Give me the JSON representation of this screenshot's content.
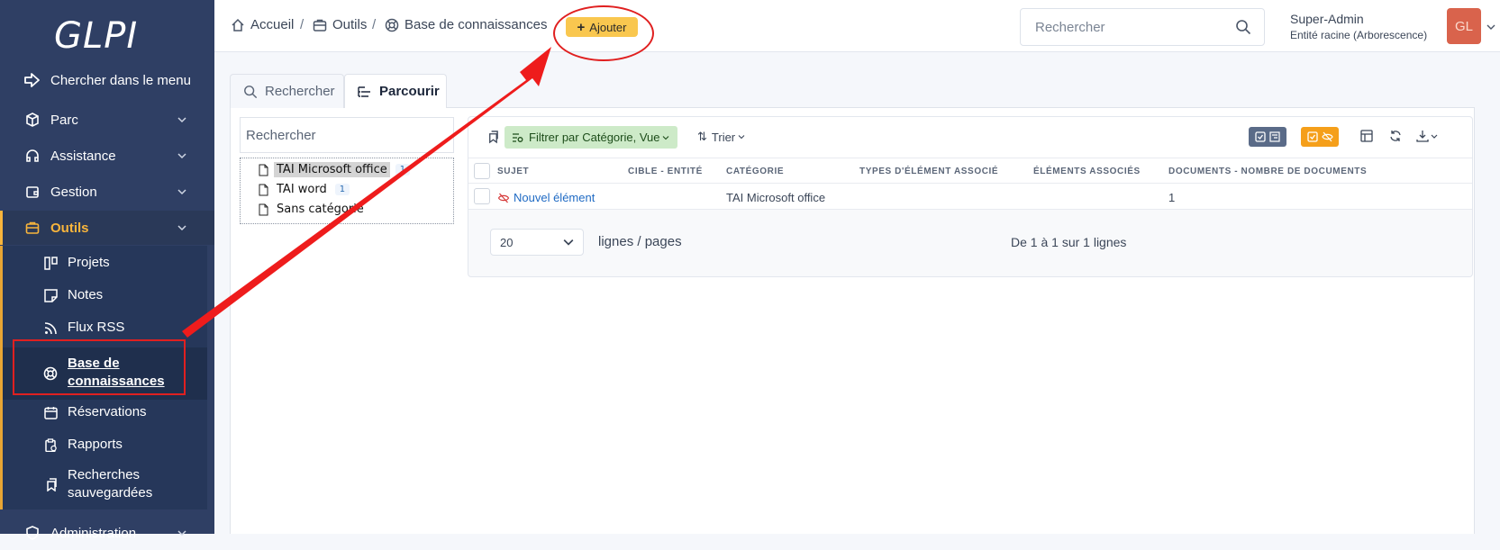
{
  "sidebar": {
    "logo": "GLPI",
    "search_label": "Chercher dans le menu",
    "items": [
      {
        "label": "Parc",
        "icon": "cube-icon"
      },
      {
        "label": "Assistance",
        "icon": "headset-icon"
      },
      {
        "label": "Gestion",
        "icon": "wallet-icon"
      },
      {
        "label": "Outils",
        "icon": "briefcase-icon"
      },
      {
        "label": "Administration",
        "icon": "shield-icon"
      }
    ],
    "submenu": [
      {
        "label": "Projets",
        "icon": "columns-icon"
      },
      {
        "label": "Notes",
        "icon": "note-icon"
      },
      {
        "label": "Flux RSS",
        "icon": "rss-icon"
      },
      {
        "label": "Base de connaissances",
        "line1": "Base de",
        "line2": "connaissances",
        "icon": "lifebuoy-icon"
      },
      {
        "label": "Réservations",
        "icon": "calendar-icon"
      },
      {
        "label": "Rapports",
        "icon": "report-icon"
      },
      {
        "label": "Recherches sauvegardées",
        "line1": "Recherches",
        "line2": "sauvegardées",
        "icon": "bookmark-icon"
      }
    ]
  },
  "breadcrumb": [
    "Accueil",
    "Outils",
    "Base de connaissances"
  ],
  "add_label": "Ajouter",
  "search": {
    "placeholder": "Rechercher"
  },
  "user": {
    "name": "Super-Admin",
    "entity": "Entité racine (Arborescence)",
    "initials": "GL"
  },
  "tabs": [
    "Rechercher",
    "Parcourir"
  ],
  "tree": {
    "search_placeholder": "Rechercher",
    "items": [
      {
        "label": "TAI Microsoft office",
        "count": "1"
      },
      {
        "label": "TAI word",
        "count": "1"
      },
      {
        "label": "Sans catégorie",
        "count": ""
      }
    ]
  },
  "toolbar": {
    "filter_label": "Filtrer par Catégorie, Vue",
    "sort_label": "Trier"
  },
  "table": {
    "columns": [
      "SUJET",
      "CIBLE - ENTITÉ",
      "CATÉGORIE",
      "TYPES D'ÉLÉMENT ASSOCIÉ",
      "ÉLÉMENTS ASSOCIÉS",
      "DOCUMENTS - NOMBRE DE DOCUMENTS"
    ],
    "rows": [
      {
        "subject": "Nouvel élément",
        "entity": "",
        "category": "TAI Microsoft office",
        "types": "",
        "items": "",
        "documents": "1"
      }
    ]
  },
  "pager": {
    "per_page": "20",
    "per_page_label": "lignes / pages",
    "info": "De 1 à 1 sur 1 lignes"
  },
  "colors": {
    "sidebar": "#2f3f64",
    "accent": "#f8b53c",
    "annotation": "#e02020",
    "filter": "#cdeac8",
    "avatar": "#d9634c"
  }
}
